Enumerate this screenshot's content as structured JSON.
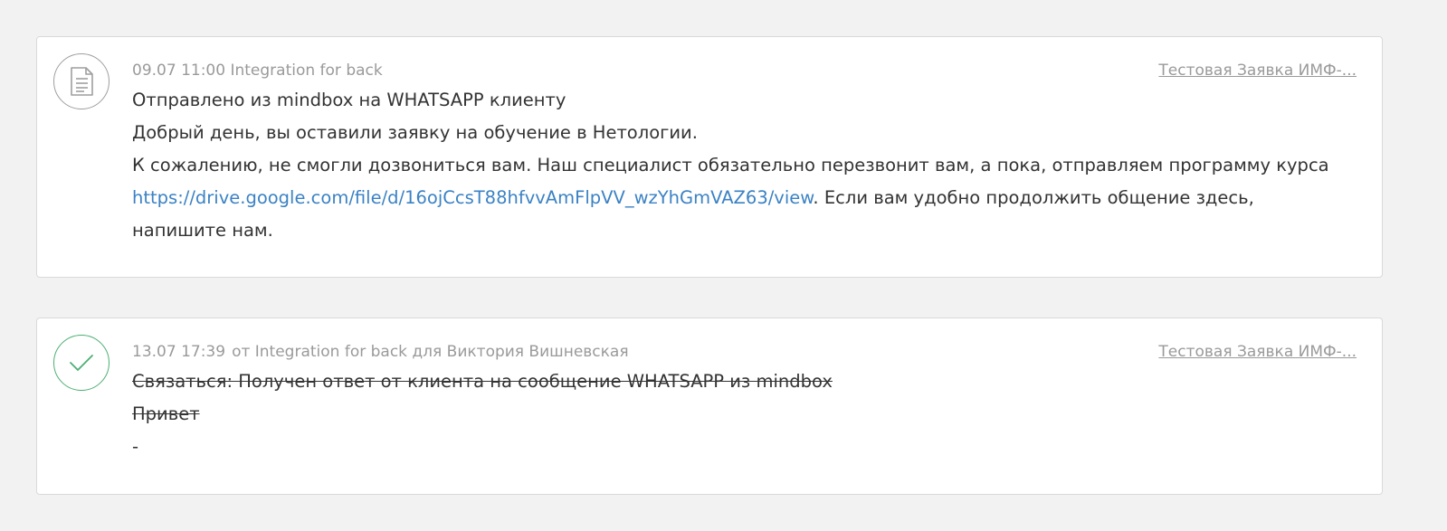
{
  "events": [
    {
      "icon": "document-icon",
      "datetime": "09.07 11:00",
      "author": "Integration for back",
      "deal_link": "Тестовая Заявка ИМФ-...",
      "title": "Отправлено из mindbox на WHATSAPP клиенту",
      "line1": "Добрый день, вы оставили заявку на обучение в Нетологии.",
      "body_before": "К сожалению, не смогли дозвониться вам. Наш специалист обязательно перезвонит вам, а пока, отправляем программу курса ",
      "url": "https://drive.google.com/file/d/16ojCcsT88hfvvAmFlpVV_wzYhGmVAZ63/view",
      "body_after": ". Если вам удобно продолжить общение здесь, напишите нам."
    },
    {
      "icon": "check-icon",
      "datetime": "13.07 17:39",
      "author_line": "от Integration for back для Виктория Вишневская",
      "deal_link": "Тестовая Заявка ИМФ-...",
      "task_title": "Связаться: Получен ответ от клиента на сообщение WHATSAPP из mindbox",
      "task_text": "Привет",
      "task_result": "-"
    }
  ],
  "colors": {
    "link": "#3b82c4",
    "meta": "#9a9a9a",
    "check": "#4caf73"
  }
}
